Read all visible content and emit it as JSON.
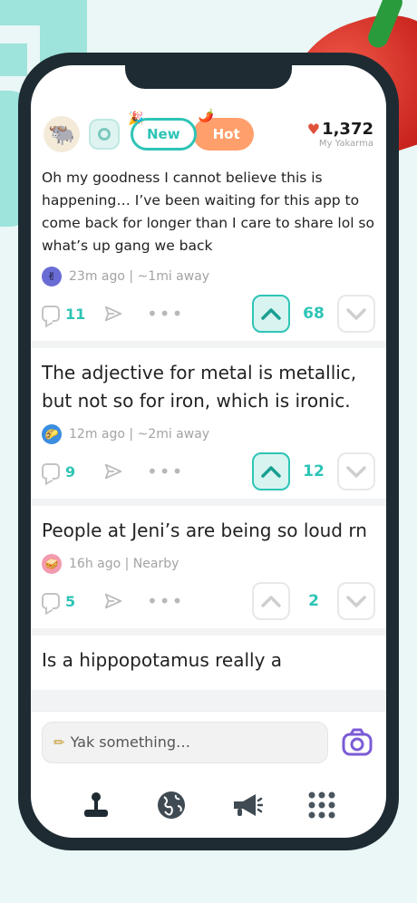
{
  "header": {
    "toggle_new": "New",
    "toggle_hot": "Hot",
    "karma_value": "1,372",
    "karma_label": "My Yakarma"
  },
  "posts": [
    {
      "text": "Oh my goodness I cannot believe this is happening… I’ve been waiting for this app to come back for longer than I care to share lol so what’s up gang we back",
      "meta": "23m ago | ~1mi away",
      "comments": "11",
      "votes": "68",
      "upvoted": true,
      "avatar_emoji": "✌️",
      "avatar_color": "#6a6cd6"
    },
    {
      "text": "The adjective for metal is metallic, but not so for iron, which is ironic.",
      "meta": "12m ago | ~2mi away",
      "comments": "9",
      "votes": "12",
      "upvoted": true,
      "avatar_emoji": "🌮",
      "avatar_color": "#3b8de0"
    },
    {
      "text": "People at Jeni’s are being so loud rn",
      "meta": "16h ago | Nearby",
      "comments": "5",
      "votes": "2",
      "upvoted": false,
      "avatar_emoji": "🥪",
      "avatar_color": "#f39ab0"
    },
    {
      "text": "Is a hippopotamus really a"
    }
  ],
  "compose": {
    "placeholder": "Yak something…"
  },
  "nav": [
    "joystick-icon",
    "globe-icon",
    "megaphone-icon",
    "grid-icon"
  ],
  "colors": {
    "accent": "#2ec4b6",
    "hot": "#ff9f6b",
    "camera": "#7b5bd6"
  }
}
